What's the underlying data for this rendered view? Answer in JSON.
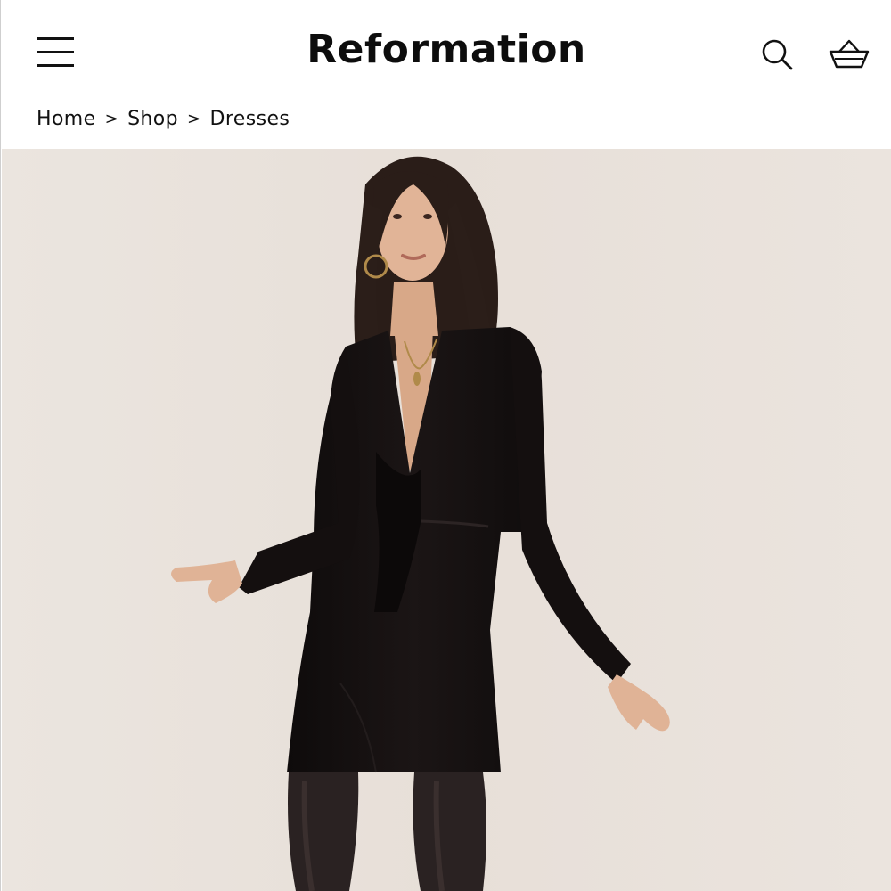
{
  "header": {
    "brand": "Reformation",
    "menu_icon": "hamburger-menu-icon",
    "search_icon": "search-icon",
    "cart_icon": "shopping-basket-icon"
  },
  "breadcrumb": {
    "items": [
      "Home",
      "Shop",
      "Dresses"
    ],
    "separator": ">"
  },
  "hero": {
    "image": "product-photo-model-black-dress",
    "background_color": "#e9e2dc",
    "dress_color": "#141010"
  }
}
